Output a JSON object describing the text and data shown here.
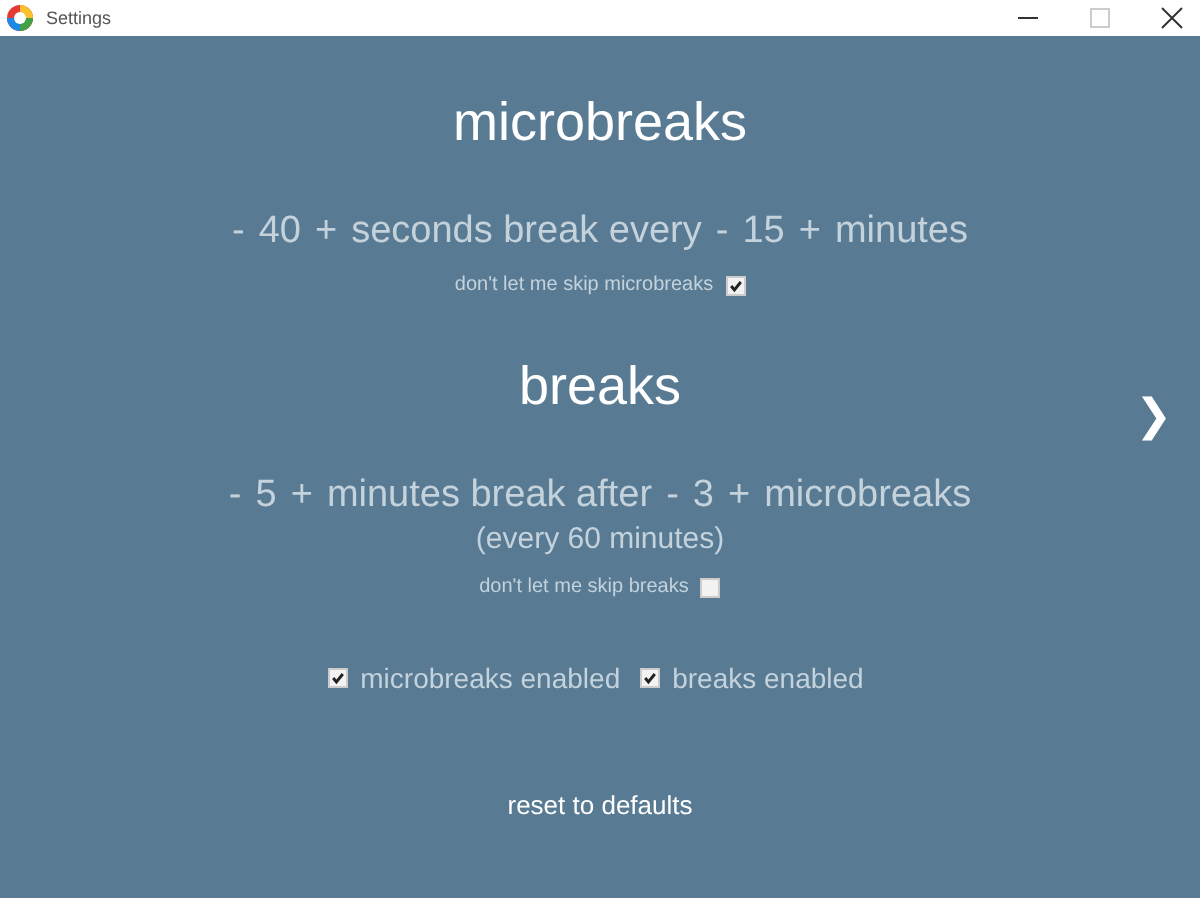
{
  "window": {
    "title": "Settings"
  },
  "sections": [
    {
      "heading": "microbreaks",
      "line": [
        {
          "kind": "stepper",
          "minus": "-",
          "value": "40",
          "plus": "+"
        },
        {
          "kind": "text",
          "text": "seconds break every"
        },
        {
          "kind": "stepper",
          "minus": "-",
          "value": "15",
          "plus": "+"
        },
        {
          "kind": "text",
          "text": "minutes"
        }
      ],
      "skip": {
        "label": "don't let me skip microbreaks",
        "checked": true
      }
    },
    {
      "heading": "breaks",
      "line": [
        {
          "kind": "stepper",
          "minus": "-",
          "value": "5",
          "plus": "+"
        },
        {
          "kind": "text",
          "text": "minutes break after"
        },
        {
          "kind": "stepper",
          "minus": "-",
          "value": "3",
          "plus": "+"
        },
        {
          "kind": "text",
          "text": "microbreaks"
        }
      ],
      "note": "(every 60 minutes)",
      "skip": {
        "label": "don't let me skip breaks",
        "checked": false
      }
    }
  ],
  "toggles": [
    {
      "label": "microbreaks enabled",
      "checked": true
    },
    {
      "label": "breaks enabled",
      "checked": true
    }
  ],
  "reset": "reset to defaults",
  "next": "❯"
}
